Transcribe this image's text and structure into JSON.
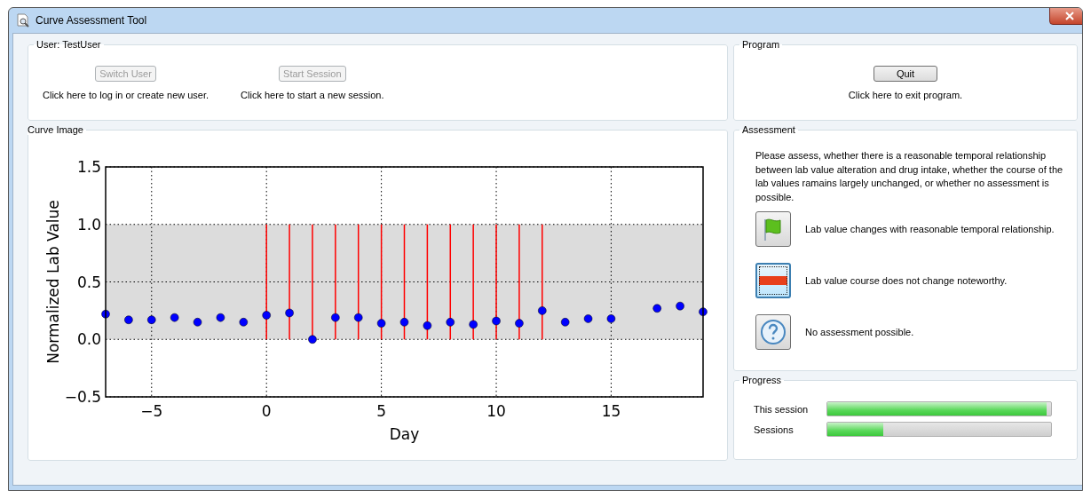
{
  "window": {
    "title": "Curve Assessment Tool"
  },
  "user_group": {
    "title": "User: TestUser",
    "actions": [
      {
        "button": "Switch User",
        "disabled": true,
        "hint": "Click here to log in or create new user."
      },
      {
        "button": "Start Session",
        "disabled": true,
        "hint": "Click here to start a new session."
      }
    ]
  },
  "program_group": {
    "title": "Program",
    "button": "Quit",
    "disabled": false,
    "hint": "Click here to exit program."
  },
  "curve_group": {
    "title": "Curve Image",
    "chart_data": {
      "type": "scatter",
      "xlabel": "Day",
      "ylabel": "Normalized Lab Value",
      "x": [
        -7,
        -6,
        -5,
        -4,
        -3,
        -2,
        -1,
        0,
        1,
        2,
        3,
        4,
        5,
        6,
        7,
        8,
        9,
        10,
        11,
        12,
        13,
        14,
        15,
        16,
        17,
        18,
        19
      ],
      "xlim": [
        -7,
        19
      ],
      "ylim": [
        -0.5,
        1.5
      ],
      "xticks": [
        {
          "value": -5,
          "label": "−5"
        },
        0,
        5,
        10,
        15
      ],
      "yticks": [
        {
          "value": -0.5,
          "label": "−0.5"
        },
        {
          "value": 0,
          "label": "0.0"
        },
        {
          "value": 0.5,
          "label": "0.5"
        },
        {
          "value": 1,
          "label": "1.0"
        },
        {
          "value": 1.5,
          "label": "1.5"
        }
      ],
      "series": [
        {
          "color": "#0000ff",
          "values": [
            0.22,
            0.17,
            0.17,
            0.19,
            0.15,
            0.19,
            0.15,
            0.21,
            0.23,
            0.0,
            0.19,
            0.19,
            0.14,
            0.15,
            0.12,
            0.15,
            0.13,
            0.16,
            0.14,
            0.25,
            0.15,
            0.18,
            0.18,
            null,
            0.27,
            0.29,
            0.24
          ]
        },
        {
          "type": "bar",
          "color": "#ff0000",
          "values": [
            null,
            null,
            null,
            null,
            null,
            null,
            null,
            1,
            1,
            1,
            1,
            1,
            1,
            1,
            1,
            1,
            1,
            1,
            1,
            1,
            null,
            null,
            null,
            null,
            null,
            null,
            null
          ]
        }
      ],
      "grid": true,
      "bands": [
        {
          "axis": "y",
          "from": 0,
          "to": 1
        }
      ]
    }
  },
  "assessment_group": {
    "title": "Assessment",
    "instructions": "Please assess, whether there is a reasonable temporal relationship between lab value alteration and drug intake, whether the course of the lab values ramains largely unchanged, or whether no assessment is possible.",
    "options": [
      {
        "kind": "flag",
        "label": "Lab value changes with reasonable temporal relationship.",
        "selected": false
      },
      {
        "kind": "minus",
        "label": "Lab value course does not change noteworthy.",
        "selected": true
      },
      {
        "kind": "question",
        "label": "No assessment possible.",
        "selected": false
      }
    ]
  },
  "progress_group": {
    "title": "Progress",
    "bars": [
      {
        "label": "This session",
        "level": 0.98
      },
      {
        "label": "Sessions",
        "level": 0.25
      }
    ]
  }
}
